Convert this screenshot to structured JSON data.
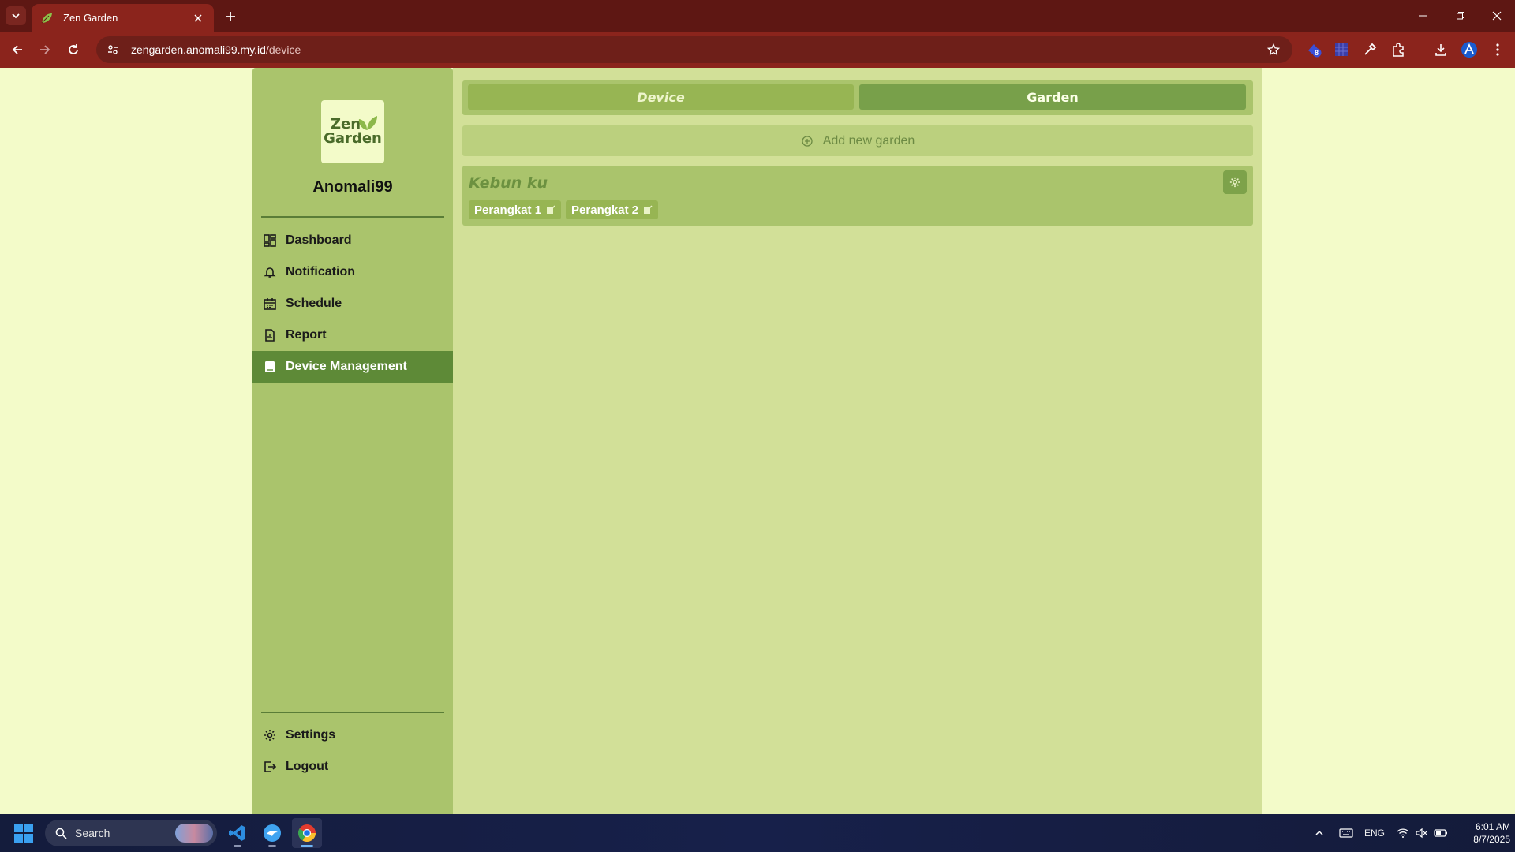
{
  "browser": {
    "tab_title": "Zen Garden",
    "url_host": "zengarden.anomali99.my.id",
    "url_path": "/device",
    "extension_badge": "8"
  },
  "sidebar": {
    "logo_line1": "Zen",
    "logo_line2": "Garden",
    "username": "Anomali99",
    "nav": [
      {
        "label": "Dashboard",
        "icon": "dashboard-icon"
      },
      {
        "label": "Notification",
        "icon": "bell-icon"
      },
      {
        "label": "Schedule",
        "icon": "calendar-icon"
      },
      {
        "label": "Report",
        "icon": "report-icon"
      },
      {
        "label": "Device Management",
        "icon": "device-icon",
        "active": true
      }
    ],
    "footer": [
      {
        "label": "Settings",
        "icon": "gear-icon"
      },
      {
        "label": "Logout",
        "icon": "logout-icon"
      }
    ]
  },
  "main": {
    "tabs": [
      {
        "label": "Device",
        "active": false
      },
      {
        "label": "Garden",
        "active": true
      }
    ],
    "add_garden_label": "Add new garden",
    "gardens": [
      {
        "name": "Kebun ku",
        "devices": [
          "Perangkat 1",
          "Perangkat 2"
        ]
      }
    ]
  },
  "taskbar": {
    "search_placeholder": "Search",
    "language": "ENG",
    "time": "6:01 AM",
    "date": "8/7/2025"
  },
  "colors": {
    "browser_frame": "#8b241c",
    "sidebar_bg": "#aac46c",
    "active_nav": "#5e8a37",
    "content_bg": "#d2e098",
    "page_bg": "#f3fbc9"
  }
}
